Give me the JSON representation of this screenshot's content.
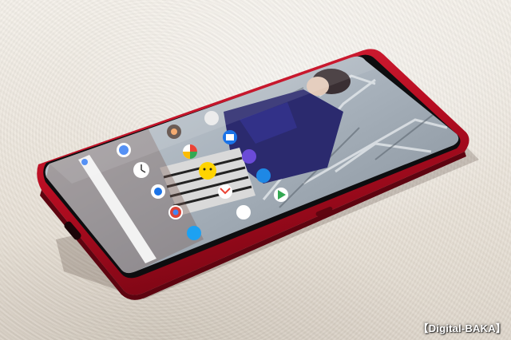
{
  "watermark": {
    "text": "【Digital-BAKA】"
  },
  "colors": {
    "phone_red": "#c8102e",
    "phone_red_dark": "#7a0614",
    "bezel": "#111111",
    "wallpaper_sky": "#b8c2cc",
    "coat": "#2b2a6e"
  },
  "home_screen": {
    "icons": [
      "clock-icon",
      "camera-icon",
      "photos-icon",
      "chrome-icon",
      "gmail-icon",
      "calendar-icon",
      "music-icon",
      "maps-icon",
      "contacts-icon",
      "play-store-icon",
      "smiley-icon",
      "twitter-icon",
      "settings-icon",
      "google-icon",
      "files-icon"
    ]
  }
}
